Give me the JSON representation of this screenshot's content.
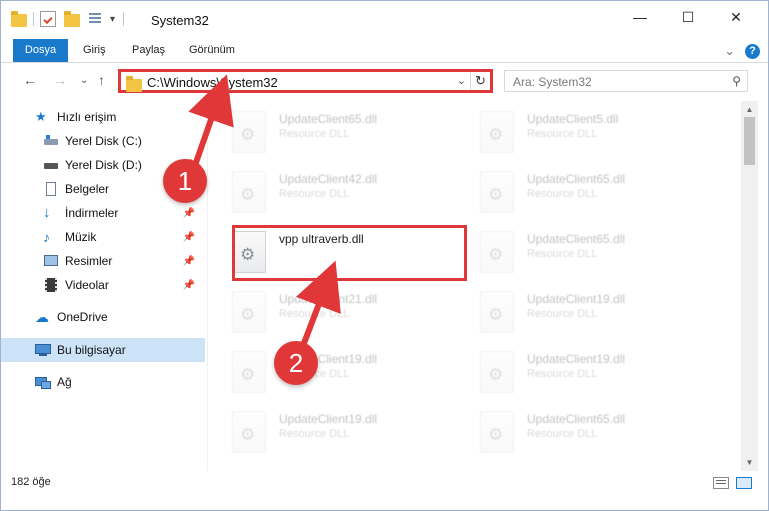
{
  "window": {
    "title": "System32",
    "minimize": "—",
    "maximize": "☐",
    "close": "✕"
  },
  "ribbon": {
    "tabs": [
      "Dosya",
      "Giriş",
      "Paylaş",
      "Görünüm"
    ],
    "expand": "⌄",
    "help": "?"
  },
  "nav": {
    "back": "←",
    "forward": "→",
    "recent": "⌄",
    "up": "↑",
    "address": "C:\\Windows\\System32",
    "address_dropdown": "⌄",
    "refresh": "↻",
    "search_placeholder": "Ara: System32",
    "search_icon": "⚲"
  },
  "sidebar": {
    "quick_access": "Hızlı erişim",
    "items": [
      {
        "label": "Yerel Disk (C:)",
        "pinned": false
      },
      {
        "label": "Yerel Disk (D:)",
        "pinned": true
      },
      {
        "label": "Belgeler",
        "pinned": true
      },
      {
        "label": "İndirmeler",
        "pinned": true
      },
      {
        "label": "Müzik",
        "pinned": true
      },
      {
        "label": "Resimler",
        "pinned": true
      },
      {
        "label": "Videolar",
        "pinned": true
      }
    ],
    "onedrive": "OneDrive",
    "this_pc": "Bu bilgisayar",
    "network": "Ağ",
    "pin_glyph": "📌"
  },
  "files": {
    "type_label": "Resource DLL",
    "left_column": [
      "UpdateClient65.dll",
      "UpdateClient42.dll",
      "vpp ultraverb.dll",
      "UpdateClient21.dll",
      "UpdateClient19.dll",
      "UpdateClient19.dll"
    ],
    "right_column": [
      "UpdateClient5.dll",
      "UpdateClient65.dll",
      "UpdateClient65.dll",
      "UpdateClient19.dll",
      "UpdateClient19.dll",
      "UpdateClient65.dll"
    ]
  },
  "status": {
    "count": "182 öğe"
  },
  "annotations": {
    "step1": "1",
    "step2": "2"
  },
  "colors": {
    "accent": "#1979ca",
    "annotation_red": "#e03838",
    "selection": "#cce3f7"
  }
}
